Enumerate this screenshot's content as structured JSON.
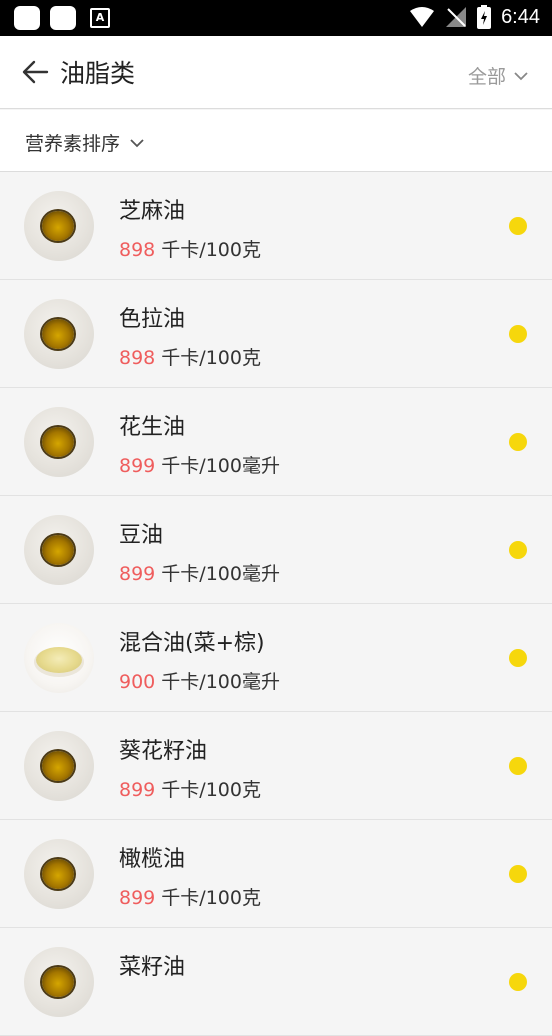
{
  "status_bar": {
    "time": "6:44",
    "icons": [
      "app-icon",
      "app-icon",
      "font-a-icon",
      "wifi-icon",
      "no-signal-icon",
      "battery-charging-icon"
    ]
  },
  "header": {
    "title": "油脂类",
    "filter_label": "全部"
  },
  "sort_bar": {
    "label": "营养素排序"
  },
  "colors": {
    "value_red": "#ef5d5d",
    "dot_yellow": "#f6d70c"
  },
  "items": [
    {
      "name": "芝麻油",
      "kcal": "898",
      "unit": " 千卡/100克",
      "thumb": "dark-oil"
    },
    {
      "name": "色拉油",
      "kcal": "898",
      "unit": " 千卡/100克",
      "thumb": "dark-oil"
    },
    {
      "name": "花生油",
      "kcal": "899",
      "unit": " 千卡/100毫升",
      "thumb": "dark-oil"
    },
    {
      "name": "豆油",
      "kcal": "899",
      "unit": " 千卡/100毫升",
      "thumb": "dark-oil"
    },
    {
      "name": "混合油(菜+棕)",
      "kcal": "900",
      "unit": " 千卡/100毫升",
      "thumb": "light-oil"
    },
    {
      "name": "葵花籽油",
      "kcal": "899",
      "unit": " 千卡/100克",
      "thumb": "dark-oil"
    },
    {
      "name": "橄榄油",
      "kcal": "899",
      "unit": " 千卡/100克",
      "thumb": "dark-oil"
    },
    {
      "name": "菜籽油",
      "kcal": "",
      "unit": "",
      "thumb": "dark-oil"
    }
  ]
}
